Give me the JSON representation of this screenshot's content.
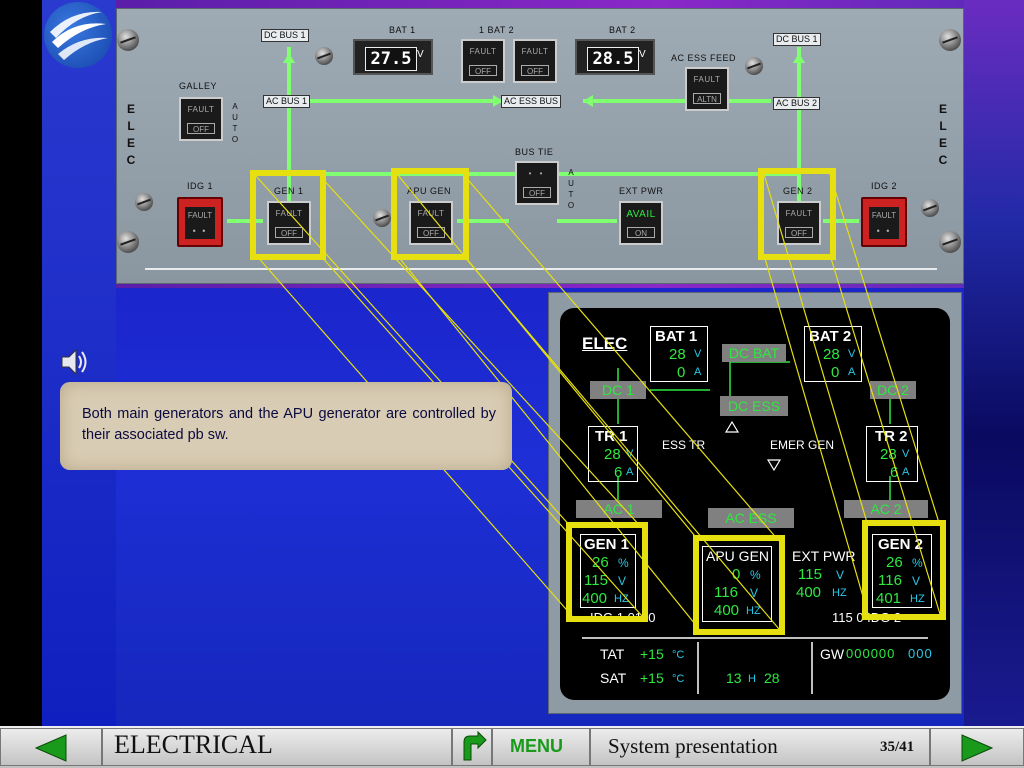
{
  "panel": {
    "elec_vertical": "ELEC",
    "auto_vertical": "AUTO",
    "bat1_label": "BAT 1",
    "bat1_value": "27.5",
    "bat1_unit": "V",
    "bat_center_label": "1   BAT   2",
    "bat2_label": "BAT 2",
    "bat2_value": "28.5",
    "bat2_unit": "V",
    "fault": "FAULT",
    "off": "OFF",
    "altn": "ALTN",
    "on": "ON",
    "avail": "AVAIL",
    "dc_bus_1_left": "DC BUS 1",
    "dc_bus_1_right": "DC BUS 1",
    "ac_bus_1": "AC BUS 1",
    "ac_ess_bus": "AC ESS BUS",
    "ac_bus_2": "AC BUS 2",
    "ac_ess_feed": "AC ESS FEED",
    "galley": "GALLEY",
    "bus_tie": "BUS TIE",
    "idg1": "IDG 1",
    "idg2": "IDG 2",
    "gen1": "GEN 1",
    "apu_gen": "APU GEN",
    "ext_pwr": "EXT PWR",
    "gen2": "GEN 2",
    "dots": "• •"
  },
  "ecam": {
    "title": "ELEC",
    "bat1": {
      "label": "BAT 1",
      "volts": "28",
      "amps": "0"
    },
    "bat2": {
      "label": "BAT 2",
      "volts": "28",
      "amps": "0"
    },
    "dc_bat": "DC BAT",
    "dc1": "DC 1",
    "dc2": "DC 2",
    "dc_ess": "DC ESS",
    "tr1": {
      "label": "TR 1",
      "volts": "28",
      "amps": "6"
    },
    "tr2": {
      "label": "TR 2",
      "volts": "28",
      "amps": "6"
    },
    "ess_tr": "ESS TR",
    "emer_gen": "EMER GEN",
    "ac1": "AC 1",
    "ac2": "AC 2",
    "ac_ess": "AC ESS",
    "gen1": {
      "label": "GEN 1",
      "pct": "26",
      "volts": "115",
      "hz": "400"
    },
    "apu_gen": {
      "label": "APU GEN",
      "pct": "0",
      "volts": "116",
      "hz": "400"
    },
    "ext_pwr": {
      "label": "EXT PWR",
      "volts": "115",
      "hz": "400"
    },
    "gen2": {
      "label": "GEN 2",
      "pct": "26",
      "volts": "116",
      "hz": "401"
    },
    "idg1_row": "IDG 1  0110",
    "idg2_row": "115  0 IDG 2",
    "unit_v": "V",
    "unit_a": "A",
    "unit_pct": "%",
    "unit_hz": "HZ",
    "tat_label": "TAT",
    "tat_value": "+15",
    "sat_label": "SAT",
    "sat_value": "+15",
    "unit_c": "°C",
    "time_h": "13",
    "time_h_label": "H",
    "time_m": "28",
    "gw_label": "GW",
    "gw_value": "000000",
    "gw_unit": "000"
  },
  "note": {
    "text": "Both main generators and the APU generator are controlled by their associated pb sw."
  },
  "bottom_bar": {
    "title": "ELECTRICAL",
    "menu": "MENU",
    "subtitle": "System presentation",
    "page": "35/41"
  },
  "colors": {
    "ecam_green": "#2ee840",
    "ecam_cyan": "#28c8e8",
    "highlight_yellow": "#e6e010",
    "bus_line_green": "#80ff70"
  }
}
